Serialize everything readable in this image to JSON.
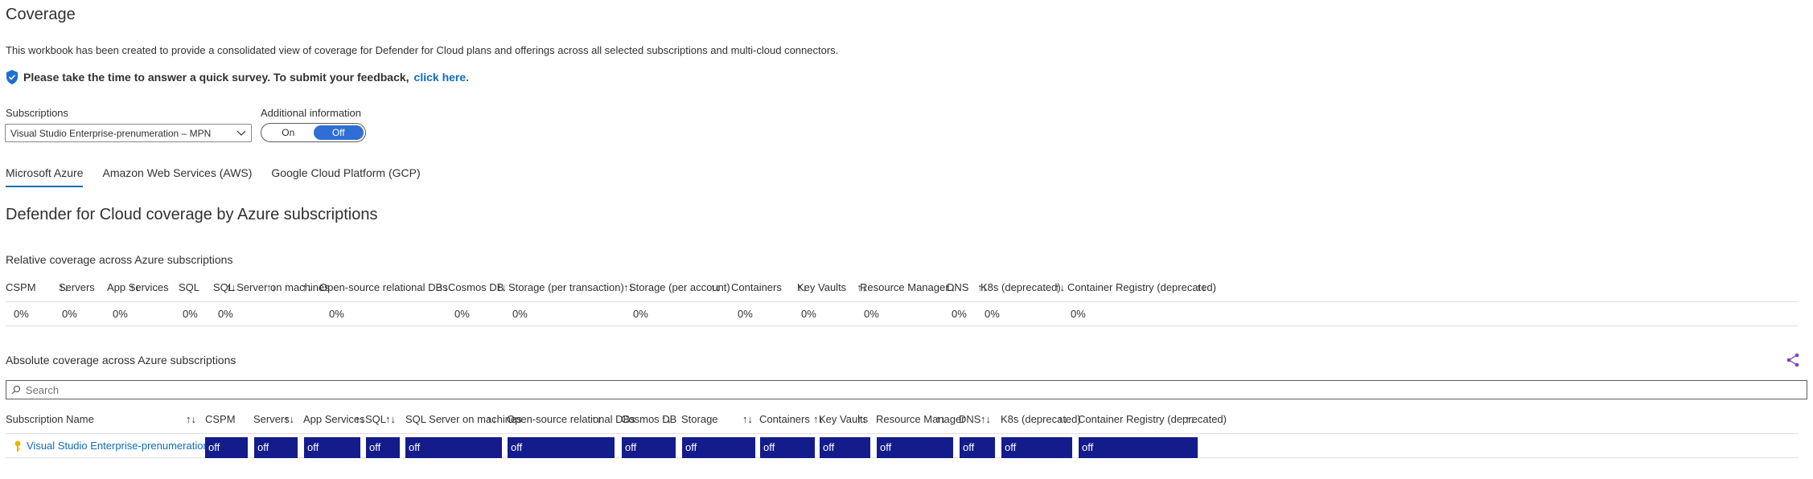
{
  "page": {
    "title": "Coverage",
    "description": "This workbook has been created to provide a consolidated view of coverage for Defender for Cloud plans and offerings across all selected subscriptions and multi-cloud connectors.",
    "survey_text": "Please take the time to answer a quick survey. To submit your feedback,",
    "survey_link": "click here."
  },
  "params": {
    "subscriptions_label": "Subscriptions",
    "subscriptions_value": "Visual Studio Enterprise-prenumeration – MPN",
    "additional_label": "Additional information",
    "toggle_on": "On",
    "toggle_off": "Off",
    "toggle_selected": "Off"
  },
  "tabs": [
    "Microsoft Azure",
    "Amazon Web Services (AWS)",
    "Google Cloud Platform (GCP)"
  ],
  "section_title": "Defender for Cloud coverage by Azure subscriptions",
  "relative": {
    "title": "Relative coverage across Azure subscriptions",
    "columns": [
      "CSPM",
      "Servers",
      "App Services",
      "SQL",
      "SQL Server on machines",
      "Open-source relational DBs",
      "Cosmos DB",
      "Storage (per transaction)",
      "Storage (per account)",
      "Containers",
      "Key Vaults",
      "Resource Manager",
      "DNS",
      "K8s (deprecated)",
      "Container Registry (deprecated)"
    ],
    "values": [
      "0%",
      "0%",
      "0%",
      "0%",
      "0%",
      "0%",
      "0%",
      "0%",
      "0%",
      "0%",
      "0%",
      "0%",
      "0%",
      "0%",
      "0%"
    ],
    "sort_glyph": "↑↓"
  },
  "absolute": {
    "title": "Absolute coverage across Azure subscriptions",
    "search_placeholder": "Search",
    "columns": [
      "Subscription Name",
      "CSPM",
      "Servers",
      "App Services",
      "SQL",
      "SQL Server on machines",
      "Open-source relational DBs",
      "Cosmos DB",
      "Storage",
      "Containers",
      "Key Vaults",
      "Resource Manager",
      "DNS",
      "K8s (deprecated)",
      "Container Registry (deprecated)"
    ],
    "rows": [
      {
        "name": "Visual Studio Enterprise-prenumeration – MPN",
        "values": [
          "off",
          "off",
          "off",
          "off",
          "off",
          "off",
          "off",
          "off",
          "off",
          "off",
          "off",
          "off",
          "off",
          "off"
        ]
      }
    ],
    "bar_color": "#141c8c"
  },
  "colors": {
    "accent": "#0f6cbd",
    "toggle_active": "#2f6fd5",
    "cell_fill": "#141c8c"
  },
  "icons": {
    "survey": "shield-icon",
    "share": "share-icon",
    "search": "search-icon",
    "subscription": "key-icon",
    "dropdown": "chevron-down-icon"
  }
}
